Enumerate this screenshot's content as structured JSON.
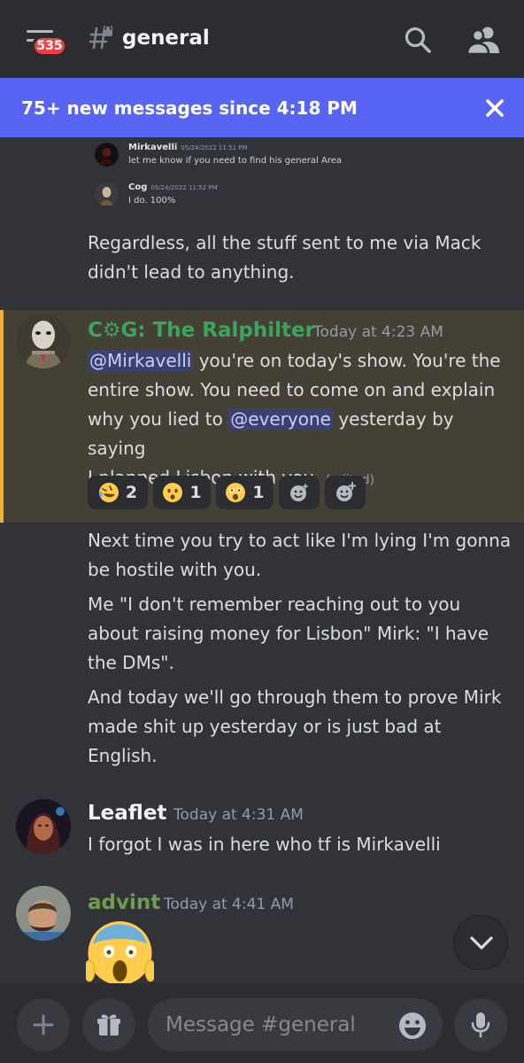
{
  "header": {
    "unread_count": "535",
    "channel_name": "general",
    "icons": [
      "menu-icon",
      "hash-icon",
      "search-icon",
      "members-icon"
    ]
  },
  "new_messages_bar": {
    "text": "75+ new messages since 4:18 PM",
    "close_icon": "close-icon"
  },
  "quoted": [
    {
      "author": "Mirkavelli",
      "time": "05/24/2022 11:51 PM",
      "text": "let me know if you need to find his general Area"
    },
    {
      "author": "Cog",
      "time": "05/24/2022 11:52 PM",
      "text": "I do. 100%"
    }
  ],
  "messages": {
    "regardless": {
      "line1": "Regardless, all the stuff sent to me via Mack",
      "line2": "didn't lead to anything."
    },
    "cog": {
      "author": "C⚙G: The Ralphilter",
      "time": "Today at 4:23 AM",
      "mention1": "@Mirkavelli",
      "line1_rest": " you're on today's show. You're the",
      "line2": "entire show. You need to come on and explain",
      "line3_pre": "why you lied to ",
      "mention2": "@everyone",
      "line3_post": " yesterday by saying",
      "line4": "I planned Lisbon with you. ",
      "edited": "(edited)",
      "reactions": [
        {
          "emoji": "rofl-emoji",
          "count": "2"
        },
        {
          "emoji": "hushed-emoji",
          "count": "1"
        },
        {
          "emoji": "astonished-emoji",
          "count": "1"
        }
      ],
      "accent_color": "#f0b132",
      "name_color": "#3ba55c"
    },
    "followups": [
      {
        "lines": [
          "Next time you try to act like I'm lying I'm gonna",
          "be hostile with you."
        ]
      },
      {
        "lines": [
          "Me \"I don't remember reaching out to you",
          "about raising money for Lisbon\" Mirk: \"I have",
          "the DMs\"."
        ]
      },
      {
        "lines": [
          "And today we'll go through them to prove Mirk",
          "made shit up yesterday or is just bad at",
          "English."
        ]
      }
    ],
    "leaflet": {
      "author": "Leaflet",
      "time": "Today at 4:31 AM",
      "text": "I forgot I was in here who tf is Mirkavelli"
    },
    "advint": {
      "author": "advint",
      "time": "Today at 4:41 AM",
      "emoji": "scream-emoji",
      "name_color": "#6e9e4d"
    }
  },
  "composer": {
    "placeholder": "Message #general",
    "icons": [
      "plus-icon",
      "gift-icon",
      "emoji-icon",
      "microphone-icon"
    ]
  },
  "colors": {
    "background": "#313338",
    "header": "#2b2d31",
    "blurple": "#5865f2",
    "highlight": "#444036"
  }
}
